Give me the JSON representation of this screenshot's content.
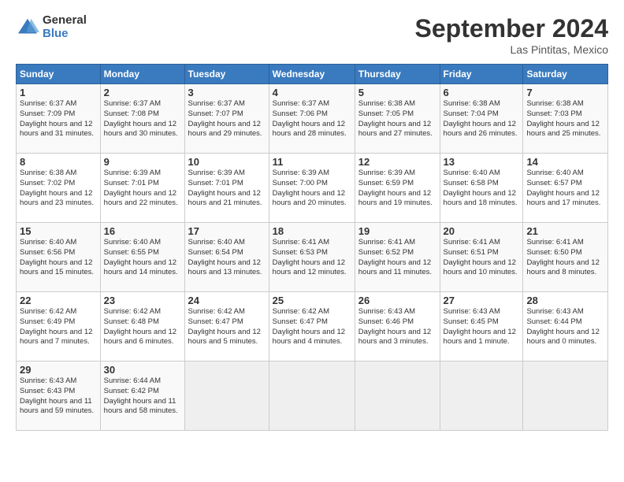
{
  "logo": {
    "general": "General",
    "blue": "Blue"
  },
  "header": {
    "title": "September 2024",
    "location": "Las Pintitas, Mexico"
  },
  "weekdays": [
    "Sunday",
    "Monday",
    "Tuesday",
    "Wednesday",
    "Thursday",
    "Friday",
    "Saturday"
  ],
  "weeks": [
    [
      {
        "day": "1",
        "sunrise": "6:37 AM",
        "sunset": "7:09 PM",
        "daylight": "12 hours and 31 minutes."
      },
      {
        "day": "2",
        "sunrise": "6:37 AM",
        "sunset": "7:08 PM",
        "daylight": "12 hours and 30 minutes."
      },
      {
        "day": "3",
        "sunrise": "6:37 AM",
        "sunset": "7:07 PM",
        "daylight": "12 hours and 29 minutes."
      },
      {
        "day": "4",
        "sunrise": "6:37 AM",
        "sunset": "7:06 PM",
        "daylight": "12 hours and 28 minutes."
      },
      {
        "day": "5",
        "sunrise": "6:38 AM",
        "sunset": "7:05 PM",
        "daylight": "12 hours and 27 minutes."
      },
      {
        "day": "6",
        "sunrise": "6:38 AM",
        "sunset": "7:04 PM",
        "daylight": "12 hours and 26 minutes."
      },
      {
        "day": "7",
        "sunrise": "6:38 AM",
        "sunset": "7:03 PM",
        "daylight": "12 hours and 25 minutes."
      }
    ],
    [
      {
        "day": "8",
        "sunrise": "6:38 AM",
        "sunset": "7:02 PM",
        "daylight": "12 hours and 23 minutes."
      },
      {
        "day": "9",
        "sunrise": "6:39 AM",
        "sunset": "7:01 PM",
        "daylight": "12 hours and 22 minutes."
      },
      {
        "day": "10",
        "sunrise": "6:39 AM",
        "sunset": "7:01 PM",
        "daylight": "12 hours and 21 minutes."
      },
      {
        "day": "11",
        "sunrise": "6:39 AM",
        "sunset": "7:00 PM",
        "daylight": "12 hours and 20 minutes."
      },
      {
        "day": "12",
        "sunrise": "6:39 AM",
        "sunset": "6:59 PM",
        "daylight": "12 hours and 19 minutes."
      },
      {
        "day": "13",
        "sunrise": "6:40 AM",
        "sunset": "6:58 PM",
        "daylight": "12 hours and 18 minutes."
      },
      {
        "day": "14",
        "sunrise": "6:40 AM",
        "sunset": "6:57 PM",
        "daylight": "12 hours and 17 minutes."
      }
    ],
    [
      {
        "day": "15",
        "sunrise": "6:40 AM",
        "sunset": "6:56 PM",
        "daylight": "12 hours and 15 minutes."
      },
      {
        "day": "16",
        "sunrise": "6:40 AM",
        "sunset": "6:55 PM",
        "daylight": "12 hours and 14 minutes."
      },
      {
        "day": "17",
        "sunrise": "6:40 AM",
        "sunset": "6:54 PM",
        "daylight": "12 hours and 13 minutes."
      },
      {
        "day": "18",
        "sunrise": "6:41 AM",
        "sunset": "6:53 PM",
        "daylight": "12 hours and 12 minutes."
      },
      {
        "day": "19",
        "sunrise": "6:41 AM",
        "sunset": "6:52 PM",
        "daylight": "12 hours and 11 minutes."
      },
      {
        "day": "20",
        "sunrise": "6:41 AM",
        "sunset": "6:51 PM",
        "daylight": "12 hours and 10 minutes."
      },
      {
        "day": "21",
        "sunrise": "6:41 AM",
        "sunset": "6:50 PM",
        "daylight": "12 hours and 8 minutes."
      }
    ],
    [
      {
        "day": "22",
        "sunrise": "6:42 AM",
        "sunset": "6:49 PM",
        "daylight": "12 hours and 7 minutes."
      },
      {
        "day": "23",
        "sunrise": "6:42 AM",
        "sunset": "6:48 PM",
        "daylight": "12 hours and 6 minutes."
      },
      {
        "day": "24",
        "sunrise": "6:42 AM",
        "sunset": "6:47 PM",
        "daylight": "12 hours and 5 minutes."
      },
      {
        "day": "25",
        "sunrise": "6:42 AM",
        "sunset": "6:47 PM",
        "daylight": "12 hours and 4 minutes."
      },
      {
        "day": "26",
        "sunrise": "6:43 AM",
        "sunset": "6:46 PM",
        "daylight": "12 hours and 3 minutes."
      },
      {
        "day": "27",
        "sunrise": "6:43 AM",
        "sunset": "6:45 PM",
        "daylight": "12 hours and 1 minute."
      },
      {
        "day": "28",
        "sunrise": "6:43 AM",
        "sunset": "6:44 PM",
        "daylight": "12 hours and 0 minutes."
      }
    ],
    [
      {
        "day": "29",
        "sunrise": "6:43 AM",
        "sunset": "6:43 PM",
        "daylight": "11 hours and 59 minutes."
      },
      {
        "day": "30",
        "sunrise": "6:44 AM",
        "sunset": "6:42 PM",
        "daylight": "11 hours and 58 minutes."
      },
      null,
      null,
      null,
      null,
      null
    ]
  ]
}
